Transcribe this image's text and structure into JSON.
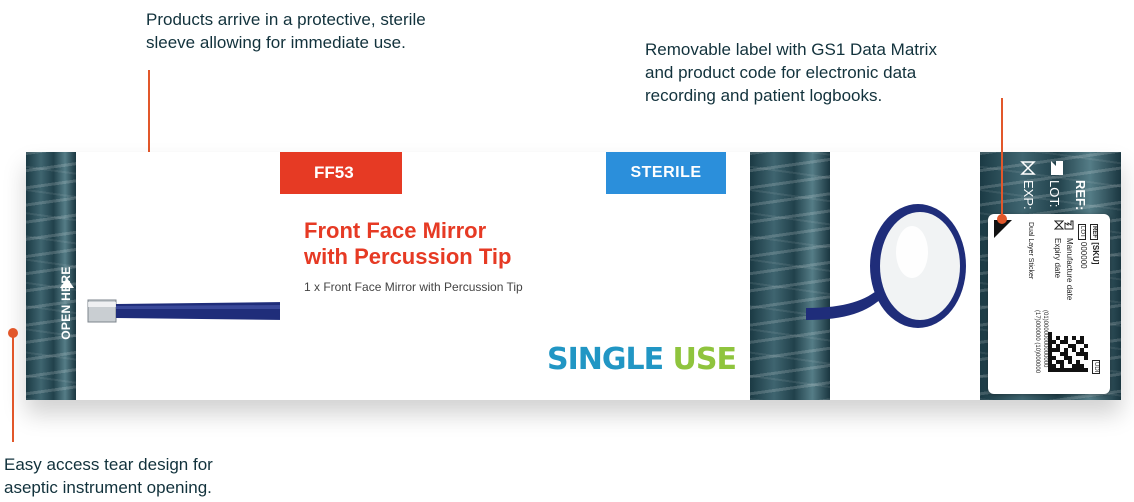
{
  "callouts": {
    "sleeve": [
      "Products arrive in a protective, sterile",
      "sleeve allowing for immediate use."
    ],
    "label": [
      "Removable label with GS1 Data Matrix",
      "and product code for electronic data",
      "recording and patient logbooks."
    ],
    "tear": [
      "Easy access tear design for",
      "aseptic instrument opening."
    ]
  },
  "package": {
    "open_here": "OPEN HERE",
    "product_code": "FF53",
    "sterile": "STERILE",
    "title_lines": [
      "Front Face Mirror",
      "with Percussion Tip"
    ],
    "subtitle": "1 x Front Face Mirror with Percussion Tip",
    "single": "SINGLE",
    "use": "USE",
    "ref_fields": [
      "REF:",
      "LOT:",
      "EXP:"
    ]
  },
  "sticker": {
    "ref": "[SKU]",
    "lot": "000000",
    "manufacture": "Manufacture date",
    "expiry": "Expiry date",
    "dual": "Dual Layer Sticker",
    "gs1_line1": "(01)00000000000000",
    "gs1_line2": "(17)000000 (10)000000",
    "udi": "UDI"
  },
  "colors": {
    "accent": "#e2572a",
    "brand_red": "#e63a24",
    "sterile_blue": "#2b8fdb",
    "single_blue": "#2196c4",
    "use_green": "#8fc43d",
    "instrument_blue": "#1f2d7a"
  }
}
